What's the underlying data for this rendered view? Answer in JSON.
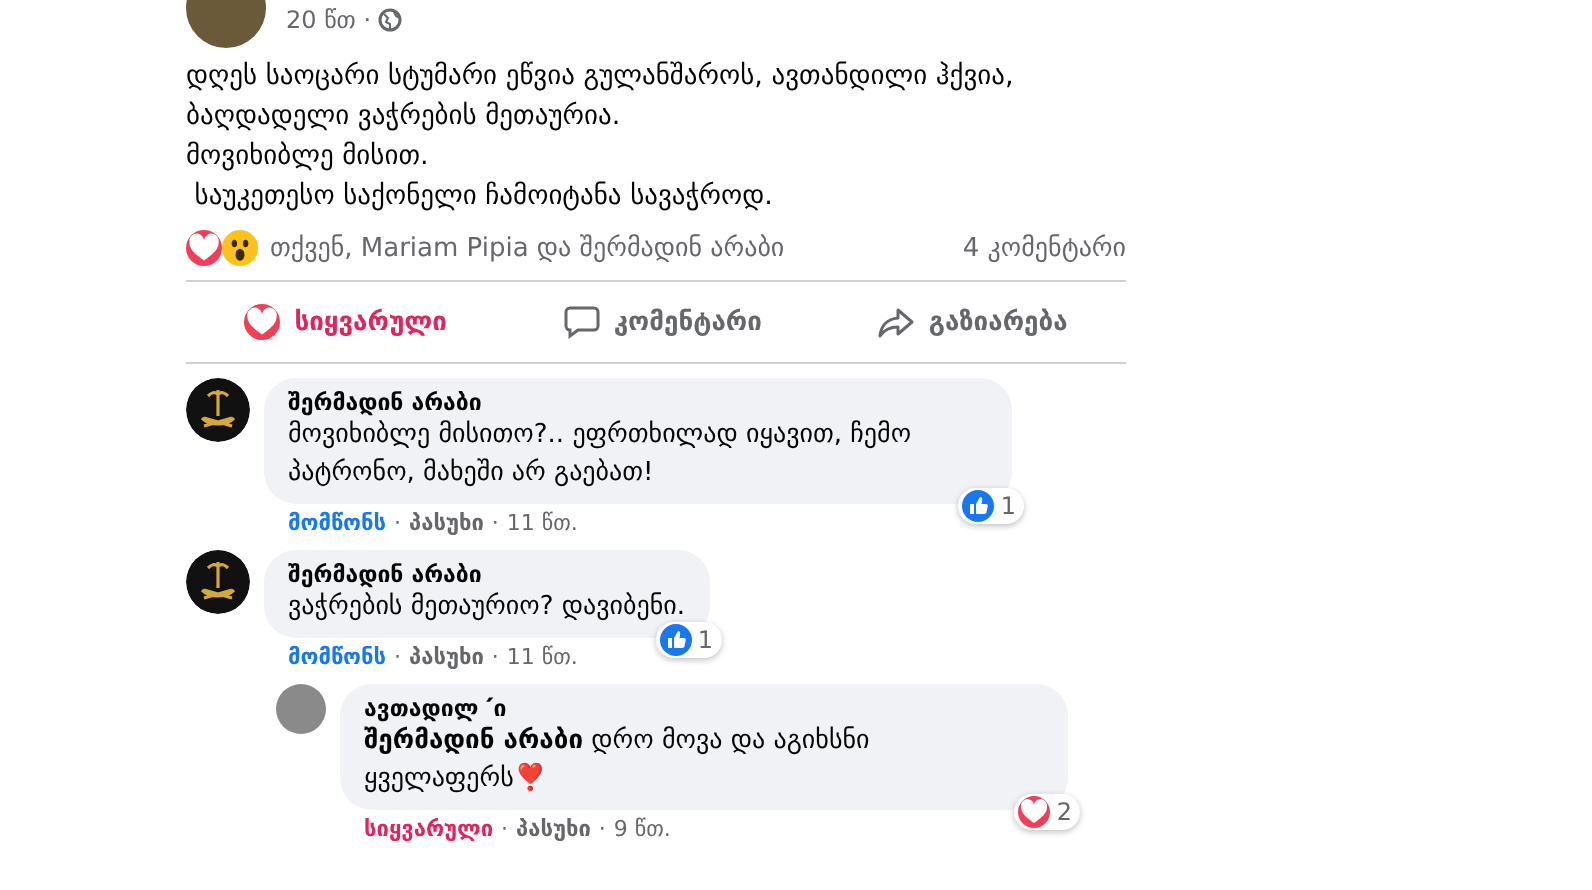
{
  "post": {
    "time": "20 წთ ·",
    "text": [
      "დღეს საოცარი სტუმარი ეწვია გულანშაროს, ავთანდილი ჰქვია,",
      "ბაღდადელი ვაჭრების მეთაურია.",
      "მოვიხიბლე მისით.",
      " საუკეთესო საქონელი ჩამოიტანა სავაჭროდ."
    ],
    "reactions": {
      "icons": [
        {
          "kind": "love"
        },
        {
          "kind": "wow"
        }
      ],
      "names": "თქვენ, Mariam Pipia და შერმადინ არაბი",
      "comments": "4 კომენტარი"
    },
    "actions": [
      {
        "kind": "love",
        "label": "სიყვარული",
        "selected": true
      },
      {
        "kind": "comment",
        "label": "კომენტარი",
        "selected": false
      },
      {
        "kind": "share",
        "label": "გაზიარება",
        "selected": false
      }
    ]
  },
  "comments": [
    {
      "author": "შერმადინ არაბი",
      "avatar": {
        "kind": "emblem"
      },
      "text": "მოვიხიბლე მისითო?.. ეფრთხილად იყავით, ჩემო პატრონო, მახეში არ გაებათ!",
      "reaction": {
        "kind": "like",
        "count": "1"
      },
      "my_reaction": {
        "kind": "like"
      },
      "actions": [
        "მომწონს",
        "პასუხი",
        "11 წთ."
      ],
      "sep": "·",
      "reply": false
    },
    {
      "author": "შერმადინ არაბი",
      "avatar": {
        "kind": "emblem"
      },
      "text": "ვაჭრების მეთაურიო? დავიბენი.",
      "reaction": {
        "kind": "like",
        "count": "1"
      },
      "my_reaction": {
        "kind": "like"
      },
      "actions": [
        "მომწონს",
        "პასუხი",
        "11 წთ."
      ],
      "sep": "·",
      "reply": false
    },
    {
      "author": "ავთადილ ՛ი",
      "avatar": {
        "kind": "photo"
      },
      "text": "**შერმადინ არაბი** დრო მოვა და აგიხსნი ყველაფერს❣️",
      "reaction": {
        "kind": "love",
        "count": "2"
      },
      "my_reaction": {
        "kind": "love"
      },
      "actions": [
        "სიყვარული",
        "პასუხი",
        "9 წთ."
      ],
      "sep": "·",
      "reply": true
    }
  ]
}
